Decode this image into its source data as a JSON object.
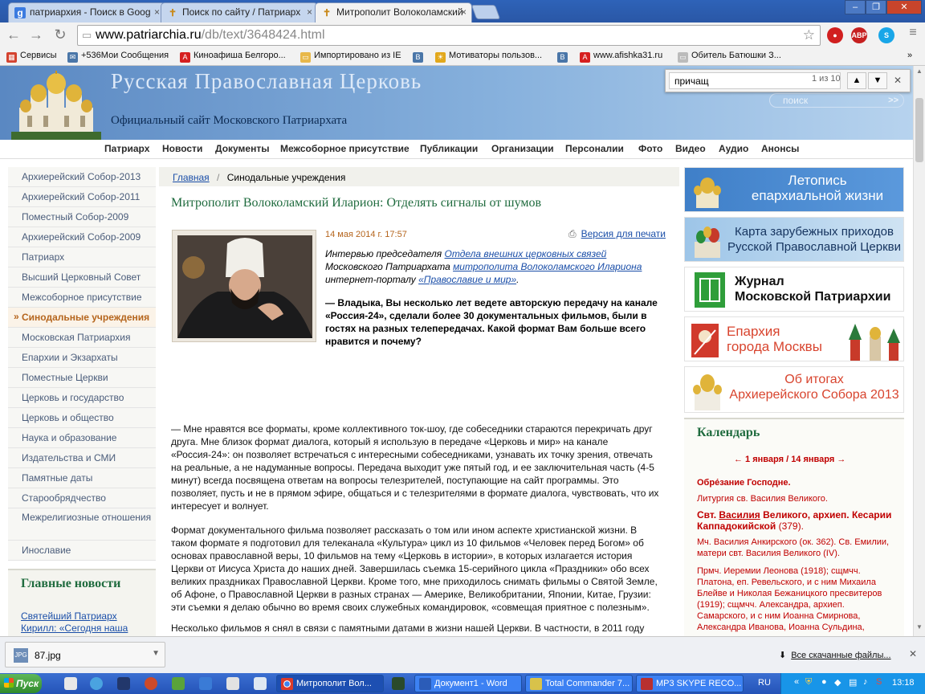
{
  "browser": {
    "tabs": [
      {
        "title": "патриархия - Поиск в Goog",
        "icon": "google-g"
      },
      {
        "title": "Поиск по сайту / Патриарх",
        "icon": "cross"
      },
      {
        "title": "Митрополит Волоколамский",
        "icon": "cross"
      }
    ],
    "url_prefix": "www.patriarchia.ru",
    "url_path": "/db/text/3648424.html",
    "ext_abp": "ABP",
    "bookmarks": [
      "Сервисы",
      "+536Мои Сообщения",
      "Киноафиша Белгоро...",
      "Импортировано из IE",
      "",
      "Мотиваторы пользов...",
      "",
      "www.afishka31.ru",
      "Обитель Батюшки З..."
    ]
  },
  "find": {
    "query": "причащ",
    "count": "1 из 10"
  },
  "site": {
    "name": "Русская  Православная  Церковь",
    "subtitle": "Официальный сайт Московского Патриархата",
    "search": "поиск",
    "nav": [
      "Патриарх",
      "Новости",
      "Документы",
      "Межсоборное присутствие",
      "Публикации",
      "Организации",
      "Персоналии",
      "Фото",
      "Видео",
      "Аудио",
      "Анонсы"
    ]
  },
  "sidebar": {
    "items": [
      "Архиерейский Собор-2013",
      "Архиерейский Собор-2011",
      "Поместный Собор-2009",
      "Архиерейский Собор-2009",
      "Патриарх",
      "Высший Церковный Совет",
      "Межсоборное присутствие",
      "Синодальные учреждения",
      "Московская Патриархия",
      "Епархии и Экзархаты",
      "Поместные Церкви",
      "Церковь и государство",
      "Церковь и общество",
      "Наука и образование",
      "Издательства и СМИ",
      "Памятные даты",
      "Старообрядчество",
      "Межрелигиозные отношения",
      "Инославие"
    ],
    "news_title": "Главные новости",
    "news_link": "Святейший Патриарх Кирилл: «Сегодня наша"
  },
  "article": {
    "crumb_home": "Главная",
    "crumb_sep": "/",
    "crumb_current": "Синодальные учреждения",
    "title": "Митрополит Волоколамский Иларион: Отделять сигналы от шумов",
    "date": "14 мая 2014 г. 17:57",
    "print": "Версия для печати",
    "intro_1": "Интервью председателя ",
    "intro_link1": "Отдела внешних церковных связей",
    "intro_2": " Московского Патриархата ",
    "intro_link2": "митрополита Волоколамского Илариона",
    "intro_3": " интернет-порталу ",
    "intro_link3": "«Православие и мир»",
    "intro_4": ".",
    "question": "— Владыка, Вы несколько лет ведете авторскую передачу на канале «Россия-24», сделали более 30 документальных фильмов, были в гостях на разных телепередачах. Какой формат Вам больше всего нравится и почему?",
    "p1": "— Мне нравятся все форматы, кроме коллективного ток-шоу, где собеседники стараются перекричать друг друга. Мне близок формат диалога, который я использую в передаче «Церковь и мир» на канале «Россия-24»: он позволяет встречаться с интересными собеседниками, узнавать их точку зрения, отвечать на реальные, а не надуманные вопросы. Передача выходит уже пятый год, и ее заключительная часть (4-5 минут) всегда посвящена ответам на вопросы телезрителей, поступающие на сайт программы. Это позволяет, пусть и не в прямом эфире, общаться и с телезрителями в формате диалога, чувствовать, что их интересует и волнует.",
    "p2": "Формат документального фильма позволяет рассказать о том или ином аспекте христианской жизни. В таком формате я подготовил для телеканала «Культура» цикл из 10 фильмов «Человек перед Богом» об основах православной веры, 10 фильмов на тему «Церковь в истории», в которых излагается история Церкви от Иисуса Христа до наших дней. Завершилась съемка 15-серийного цикла «Праздники» обо всех великих праздниках Православной Церкви. Кроме того, мне приходилось снимать фильмы о Святой Земле, об Афоне, о Православной Церкви в разных странах — Америке, Великобритании, Японии, Китае, Грузии: эти съемки я делаю обычно во время своих служебных командировок, «совмещая приятное с полезным».",
    "p3": "Несколько фильмов я снял в связи с памятными датами в жизни нашей Церкви. В частности, в 2011 году для телеканала «Россия-1» был снят фильм «Путь пастыря», посвященный 65-летию со дня рождения Святейшего Патриарха Кирилла. В прошлом году по случаю 1025-летия Крещения Руси, по благословению Святейшего Патриарха, был снят двухчасовой фильм, показанный на «России-1», о последних 25 годах жизни нашей Церкви. Задача, которую я поставил перед съемочной группой в этом фильме, была достаточно сложной: показать жизнь Церкви во всем ее многообразии на протяжении четверти века, не"
  },
  "right": {
    "b1_l1": "Летопись",
    "b1_l2": "епархиальной жизни",
    "b2_l1": "Карта зарубежных приходов",
    "b2_l2": "Русской Православной Церкви",
    "b3_l1": "Журнал",
    "b3_l2": "Московской Патриархии",
    "b4_l1": "Епархия",
    "b4_l2": "города Москвы",
    "b5_l1": "Об итогах",
    "b5_l2": "Архиерейского Собора 2013",
    "cal_title": "Календарь",
    "cal_date": "← 1 января / 14 января →",
    "cal_feast": "Обре́зание Господне.",
    "cal_1": "Литургия св. Василия Великого.",
    "cal_2a": "Свт. ",
    "cal_2b": "Василия",
    "cal_2c": " Великого, архиеп. Кесарии Каппадокийской",
    "cal_2d": " (379).",
    "cal_3": "Мч. Василия Анкирского (ок. 362). Св. Емилии, матери свт. Василия Великого (IV).",
    "cal_4": "Прмч. Иеремии Леонова (1918); сщмчч. Платона, еп. Ревельского, и с ним Михаила Блейве и Николая Бежаницкого пресвитеров (1919); сщмчч. Александра, архиеп. Самарского, и с ним Иоанна Смирнова, Александра Иванова, Иоанна Сульдина,"
  },
  "download": {
    "file": "87.jpg",
    "all": "Все скачанные файлы..."
  },
  "taskbar": {
    "start": "Пуск",
    "tasks": [
      "Митрополит Вол...",
      "Документ1 - Word",
      "Total Commander 7...",
      "MP3 SKYPE RECO..."
    ],
    "lang": "RU",
    "time": "13:18"
  },
  "colors": {
    "accent_green": "#1f6b3e",
    "link_blue": "#1a4ea8",
    "calendar_red": "#c00000",
    "date_orange": "#b5651d"
  }
}
